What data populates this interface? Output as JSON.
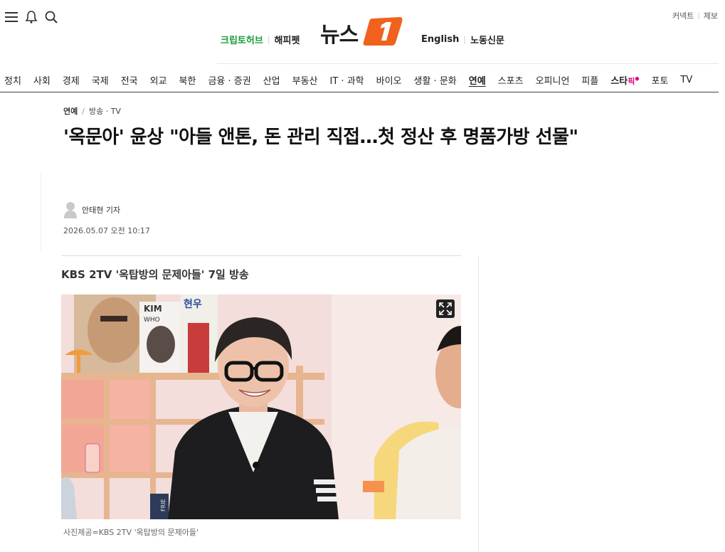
{
  "header": {
    "brand_name": "뉴스",
    "brand_mark": "1",
    "left_links": [
      "크립토허브",
      "해피펫"
    ],
    "right_links": [
      "English",
      "노동신문"
    ],
    "util_links": [
      "커넥트",
      "제보"
    ],
    "icons": [
      "menu-icon",
      "bell-icon",
      "search-icon"
    ],
    "colors": {
      "brand_orange": "#f0621e",
      "cryptohub_green": "#1a9e3e",
      "starpick_pink": "#e4007f"
    }
  },
  "nav": {
    "items": [
      "정치",
      "사회",
      "경제",
      "국제",
      "전국",
      "외교",
      "북한",
      "금융 · 증권",
      "산업",
      "부동산",
      "IT · 과학",
      "바이오",
      "생활 · 문화",
      "연예",
      "스포츠",
      "오피니언",
      "피플",
      "스타",
      "포토",
      "TV"
    ],
    "active": "연예",
    "starpick_suffix": "픽"
  },
  "article": {
    "breadcrumb": [
      "연예",
      "방송 · TV"
    ],
    "title": "'옥문아' 윤상 \"아들 앤톤, 돈 관리 직접…첫 정산 후 명품가방 선물\"",
    "reporter": "안태현 기자",
    "timestamp": "2026.05.07 오전 10:17",
    "subheadline": "KBS 2TV '옥탑방의 문제아들' 7일 방송",
    "photo_caption": "사진제공=KBS 2TV '옥탑방의 문제아들'",
    "photo_text": {
      "poster_top": "KIM",
      "poster_sub": "WHO",
      "poster_name": "현우",
      "book_spine": "FRIE"
    }
  }
}
